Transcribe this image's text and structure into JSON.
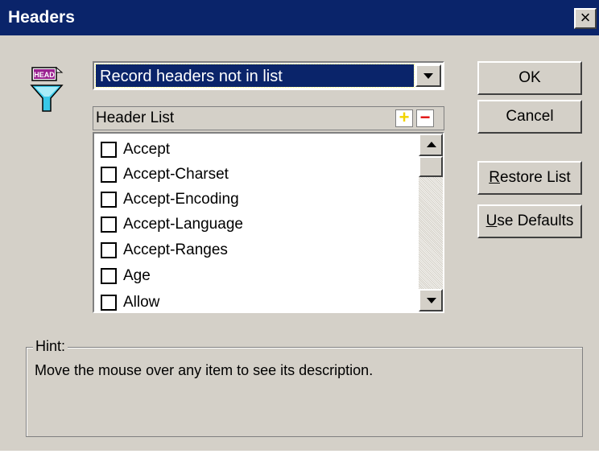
{
  "window": {
    "title": "Headers",
    "close_glyph": "×"
  },
  "icon": {
    "name": "header-filter-icon",
    "badge_text": "HEAD"
  },
  "combo": {
    "selected": "Record headers not in list"
  },
  "list": {
    "header_label": "Header List",
    "add_glyph": "+",
    "remove_glyph": "−",
    "items": [
      {
        "label": "Accept",
        "checked": false
      },
      {
        "label": "Accept-Charset",
        "checked": false
      },
      {
        "label": "Accept-Encoding",
        "checked": false
      },
      {
        "label": "Accept-Language",
        "checked": false
      },
      {
        "label": "Accept-Ranges",
        "checked": false
      },
      {
        "label": "Age",
        "checked": false
      },
      {
        "label": "Allow",
        "checked": false
      }
    ]
  },
  "buttons": {
    "ok": "OK",
    "cancel": "Cancel",
    "restore_mnemonic": "R",
    "restore_rest": "estore List",
    "defaults_mnemonic": "U",
    "defaults_rest": "se Defaults"
  },
  "hint": {
    "title": "Hint:",
    "text": "Move the mouse over any item to see its description."
  },
  "colors": {
    "dialog_bg": "#d4d0c8",
    "titlebar": "#0a246a",
    "add": "#f2d400",
    "remove": "#e01010"
  }
}
